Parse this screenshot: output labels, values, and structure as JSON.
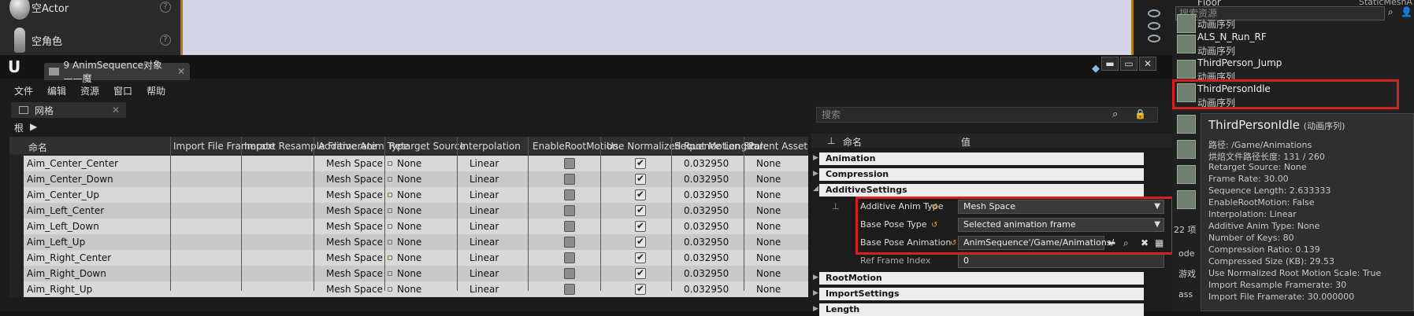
{
  "background": {
    "place_actors": [
      {
        "label": "空Actor",
        "icon": "sphere-icon"
      },
      {
        "label": "空角色",
        "icon": "character-icon"
      }
    ],
    "outliner": {
      "floor_label": "Floor",
      "type_label": "StaticMeshA"
    }
  },
  "window": {
    "tab_title": "9 AnimSequence对象——魔",
    "controls": {
      "minimize": "▬",
      "maximize": "▭",
      "close": "✕"
    }
  },
  "menu": [
    "文件",
    "编辑",
    "资源",
    "窗口",
    "帮助"
  ],
  "panel": {
    "tab_label": "网格",
    "breadcrumb": "根"
  },
  "table": {
    "columns": [
      "命名",
      "Import File Framerate",
      "Import Resample Framerate",
      "Additive Anim Type",
      "Retarget Source",
      "Interpolation",
      "EnableRootMotion",
      "Use Normalized Root Motion Scale",
      "Sequence Length",
      "Parent Asset"
    ],
    "rows": [
      {
        "name": "Aim_Center_Center",
        "additive": "Mesh Space",
        "retarget": "None",
        "interp": "Linear",
        "root": false,
        "norm": true,
        "length": "0.032950",
        "parent": "None"
      },
      {
        "name": "Aim_Center_Down",
        "additive": "Mesh Space",
        "retarget": "None",
        "interp": "Linear",
        "root": false,
        "norm": true,
        "length": "0.032950",
        "parent": "None"
      },
      {
        "name": "Aim_Center_Up",
        "additive": "Mesh Space",
        "retarget": "None",
        "interp": "Linear",
        "root": false,
        "norm": true,
        "length": "0.032950",
        "parent": "None"
      },
      {
        "name": "Aim_Left_Center",
        "additive": "Mesh Space",
        "retarget": "None",
        "interp": "Linear",
        "root": false,
        "norm": true,
        "length": "0.032950",
        "parent": "None"
      },
      {
        "name": "Aim_Left_Down",
        "additive": "Mesh Space",
        "retarget": "None",
        "interp": "Linear",
        "root": false,
        "norm": true,
        "length": "0.032950",
        "parent": "None"
      },
      {
        "name": "Aim_Left_Up",
        "additive": "Mesh Space",
        "retarget": "None",
        "interp": "Linear",
        "root": false,
        "norm": true,
        "length": "0.032950",
        "parent": "None"
      },
      {
        "name": "Aim_Right_Center",
        "additive": "Mesh Space",
        "retarget": "None",
        "interp": "Linear",
        "root": false,
        "norm": true,
        "length": "0.032950",
        "parent": "None"
      },
      {
        "name": "Aim_Right_Down",
        "additive": "Mesh Space",
        "retarget": "None",
        "interp": "Linear",
        "root": false,
        "norm": true,
        "length": "0.032950",
        "parent": "None"
      },
      {
        "name": "Aim_Right_Up",
        "additive": "Mesh Space",
        "retarget": "None",
        "interp": "Linear",
        "root": false,
        "norm": true,
        "length": "0.032950",
        "parent": "None"
      }
    ]
  },
  "details": {
    "search_placeholder": "搜索",
    "col_name": "命名",
    "col_value": "值",
    "categories": [
      "Animation",
      "Compression",
      "AdditiveSettings",
      "RootMotion",
      "ImportSettings",
      "Length"
    ],
    "props": {
      "additive_anim_type": {
        "label": "Additive Anim Type",
        "value": "Mesh Space"
      },
      "base_pose_type": {
        "label": "Base Pose Type",
        "value": "Selected animation frame"
      },
      "base_pose_animation": {
        "label": "Base Pose Animation",
        "value": "AnimSequence'/Game/Animations/"
      },
      "ref_frame_index": {
        "label": "Ref Frame Index",
        "value": "0"
      }
    }
  },
  "assets": {
    "search_placeholder": "搜索资源",
    "items": [
      {
        "name": "",
        "type": "动画序列"
      },
      {
        "name": "ALS_N_Run_RF",
        "type": "动画序列"
      },
      {
        "name": "ThirdPerson_Jump",
        "type": "动画序列"
      },
      {
        "name": "ThirdPersonIdle",
        "type": "动画序列"
      }
    ],
    "side_fragments": [
      "22 项",
      "ode",
      "游戏",
      "ass"
    ]
  },
  "tooltip": {
    "title": "ThirdPersonIdle",
    "subtitle": "(动画序列)",
    "lines": [
      "路径: /Game/Animations",
      "烘焙文件路径长度: 131 / 260",
      "Retarget Source: None",
      "Frame Rate: 30.00",
      "Sequence Length: 2.633333",
      "EnableRootMotion: False",
      "Interpolation: Linear",
      "Additive Anim Type: None",
      "Number of Keys: 80",
      "Compression Ratio: 0.139",
      "Compressed Size (KB): 29.53",
      "Use Normalized Root Motion Scale: True",
      "Import Resample Framerate: 30",
      "Import File Framerate: 30.000000"
    ]
  }
}
